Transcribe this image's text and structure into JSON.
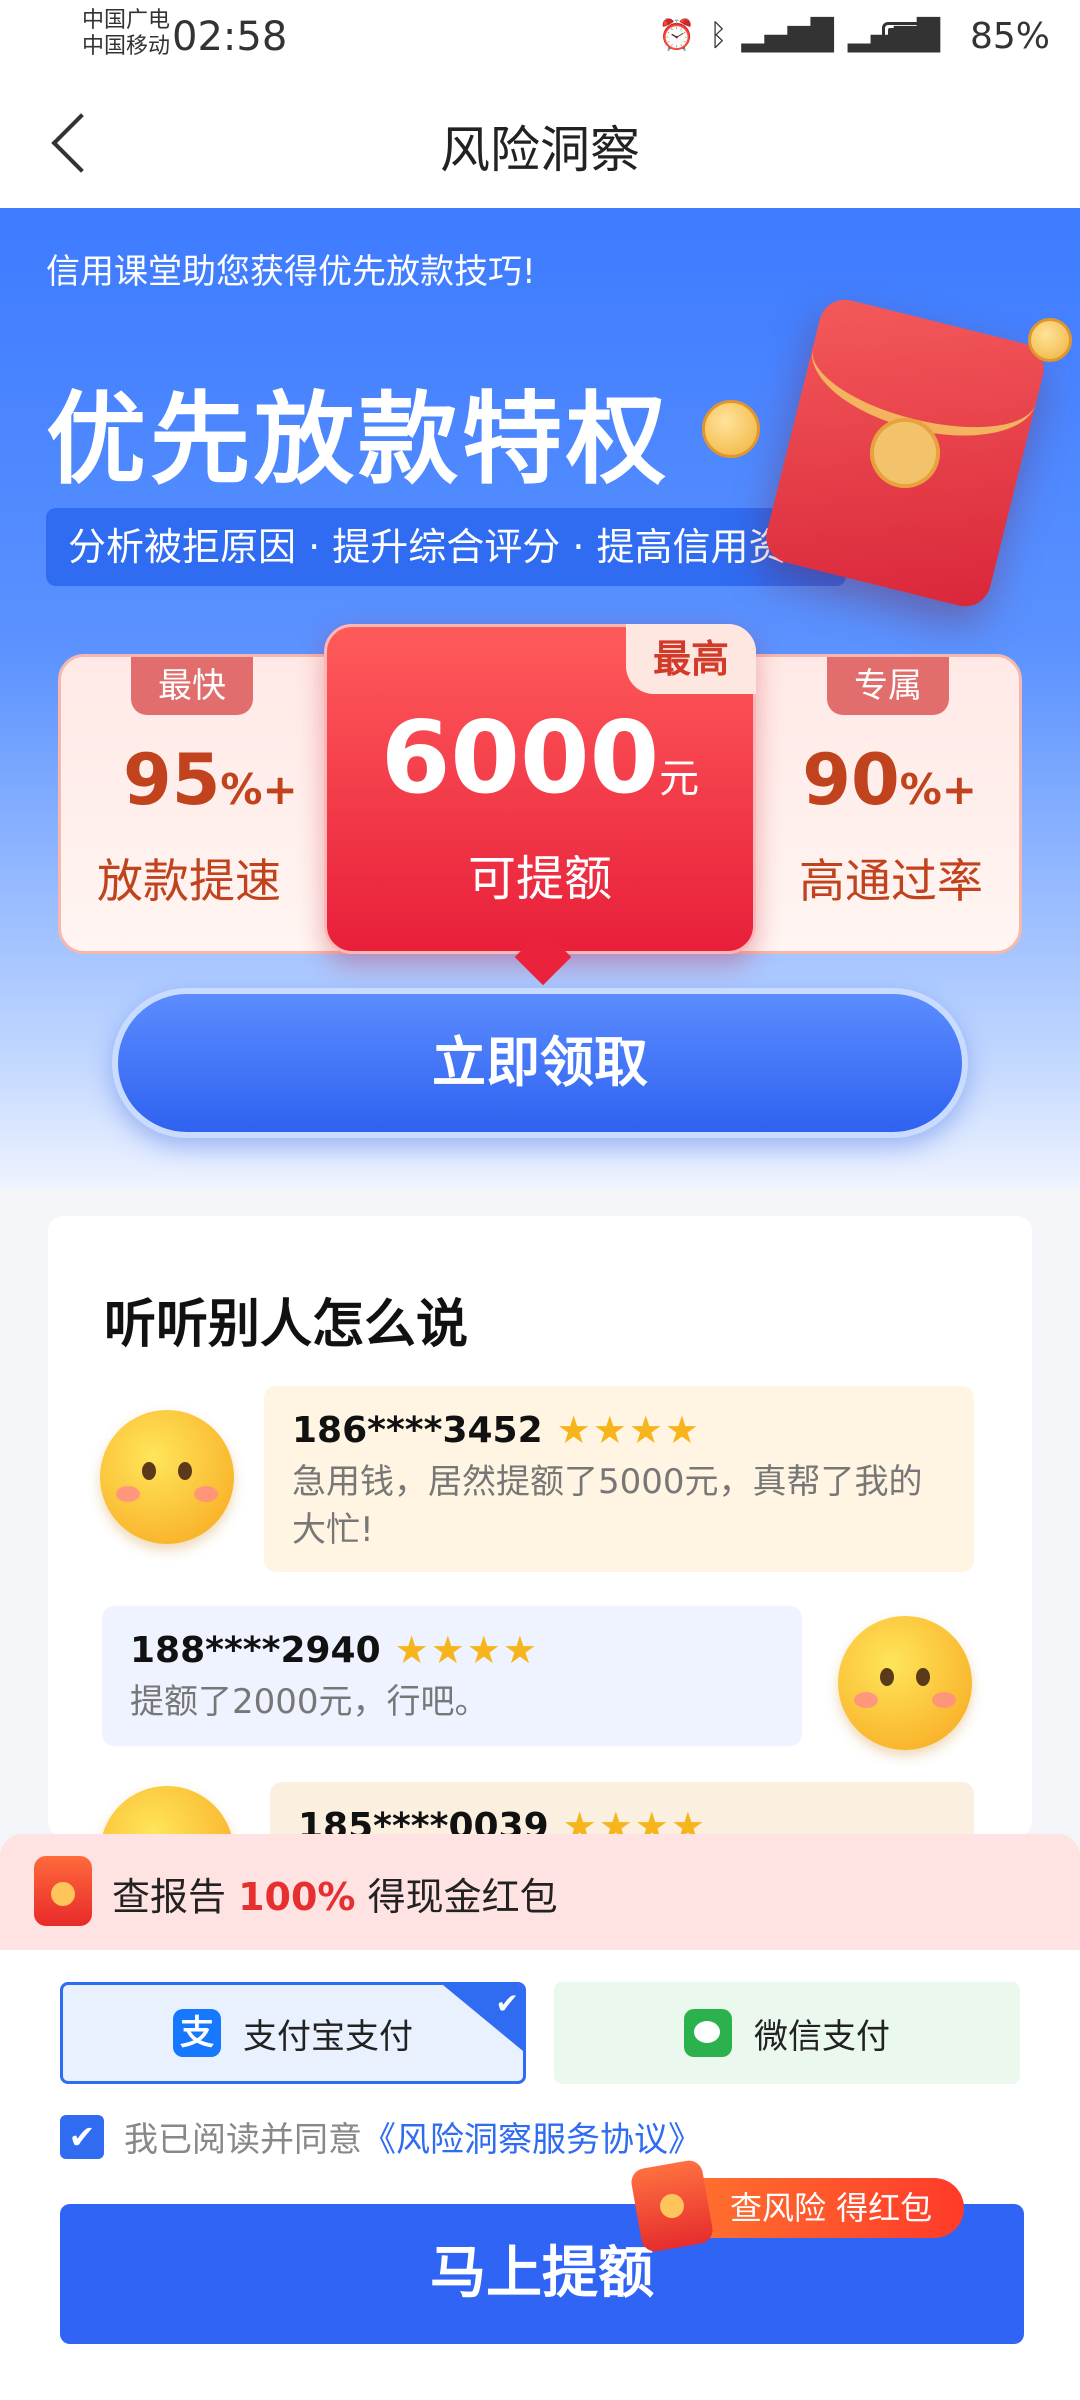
{
  "status_bar": {
    "carrier1": "中国广电",
    "carrier2": "中国移动",
    "time": "02:58",
    "battery": "85%",
    "icons": [
      "alarm-icon",
      "bluetooth-icon",
      "vibrate-icon",
      "signal-4g-icon",
      "signal-4g-icon",
      "battery-icon"
    ]
  },
  "nav": {
    "title": "风险洞察"
  },
  "hero": {
    "subtitle": "信用课堂助您获得优先放款技巧!",
    "title": "优先放款特权",
    "tagline": "分析被拒原因 · 提升综合评分 · 提高信用资质",
    "left_card": {
      "tag": "最快",
      "value": "95",
      "suffix": "%+",
      "label": "放款提速"
    },
    "main_card": {
      "tag": "最高",
      "amount": "6000",
      "unit": "元",
      "label": "可提额"
    },
    "right_card": {
      "tag": "专属",
      "value": "90",
      "suffix": "%+",
      "label": "高通过率"
    },
    "claim_button": "立即领取"
  },
  "reviews": {
    "title": "听听别人怎么说",
    "items": [
      {
        "user": "186****3452",
        "stars": "★★★★",
        "text": "急用钱，居然提额了5000元，真帮了我的大忙!"
      },
      {
        "user": "188****2940",
        "stars": "★★★★",
        "text": "提额了2000元，行吧。"
      },
      {
        "user": "185****0039",
        "stars": "★★★★",
        "text": ""
      }
    ]
  },
  "promo": {
    "prefix": "查报告 ",
    "highlight": "100%",
    "suffix": " 得现金红包"
  },
  "payment": {
    "alipay": {
      "label": "支付宝支付",
      "logo": "支",
      "selected": true
    },
    "wechat": {
      "label": "微信支付",
      "selected": false
    }
  },
  "agreement": {
    "text": "我已阅读并同意",
    "link": "《风险洞察服务协议》",
    "checked": true
  },
  "submit": {
    "label": "马上提额",
    "badge": "查风险 得红包"
  },
  "colors": {
    "primary": "#2f64f4",
    "accent_red": "#e5302f"
  }
}
